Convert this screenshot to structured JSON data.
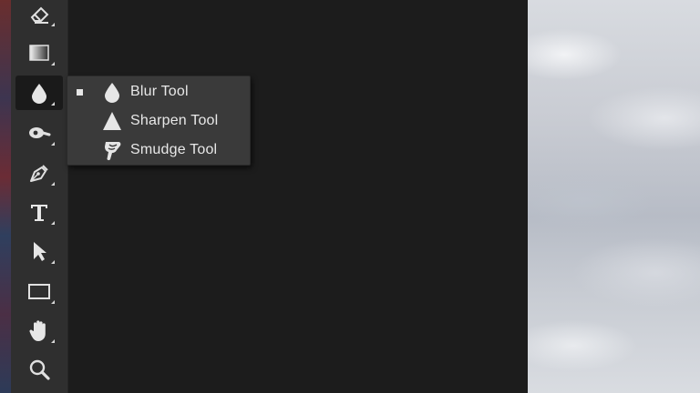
{
  "toolbar": {
    "tools": [
      {
        "name": "Eraser Tool",
        "icon": "eraser-icon"
      },
      {
        "name": "Gradient Tool",
        "icon": "gradient-icon"
      },
      {
        "name": "Blur Tool",
        "icon": "blur-drop-icon",
        "active": true
      },
      {
        "name": "Dodge Tool",
        "icon": "dodge-icon"
      },
      {
        "name": "Pen Tool",
        "icon": "pen-icon"
      },
      {
        "name": "Type Tool",
        "icon": "type-icon"
      },
      {
        "name": "Path Selection Tool",
        "icon": "arrow-icon"
      },
      {
        "name": "Rectangle Tool",
        "icon": "rectangle-icon"
      },
      {
        "name": "Hand Tool",
        "icon": "hand-icon"
      },
      {
        "name": "Zoom Tool",
        "icon": "zoom-icon"
      }
    ]
  },
  "flyout": {
    "items": [
      {
        "label": "Blur Tool",
        "icon": "blur-drop-icon",
        "selected": true
      },
      {
        "label": "Sharpen Tool",
        "icon": "sharpen-triangle-icon",
        "selected": false
      },
      {
        "label": "Smudge Tool",
        "icon": "smudge-finger-icon",
        "selected": false
      }
    ]
  },
  "colors": {
    "toolbar_bg": "#2f2f2f",
    "canvas_bg": "#1c1c1c",
    "flyout_bg": "#3a3a3a",
    "text": "#e8e8e8"
  }
}
